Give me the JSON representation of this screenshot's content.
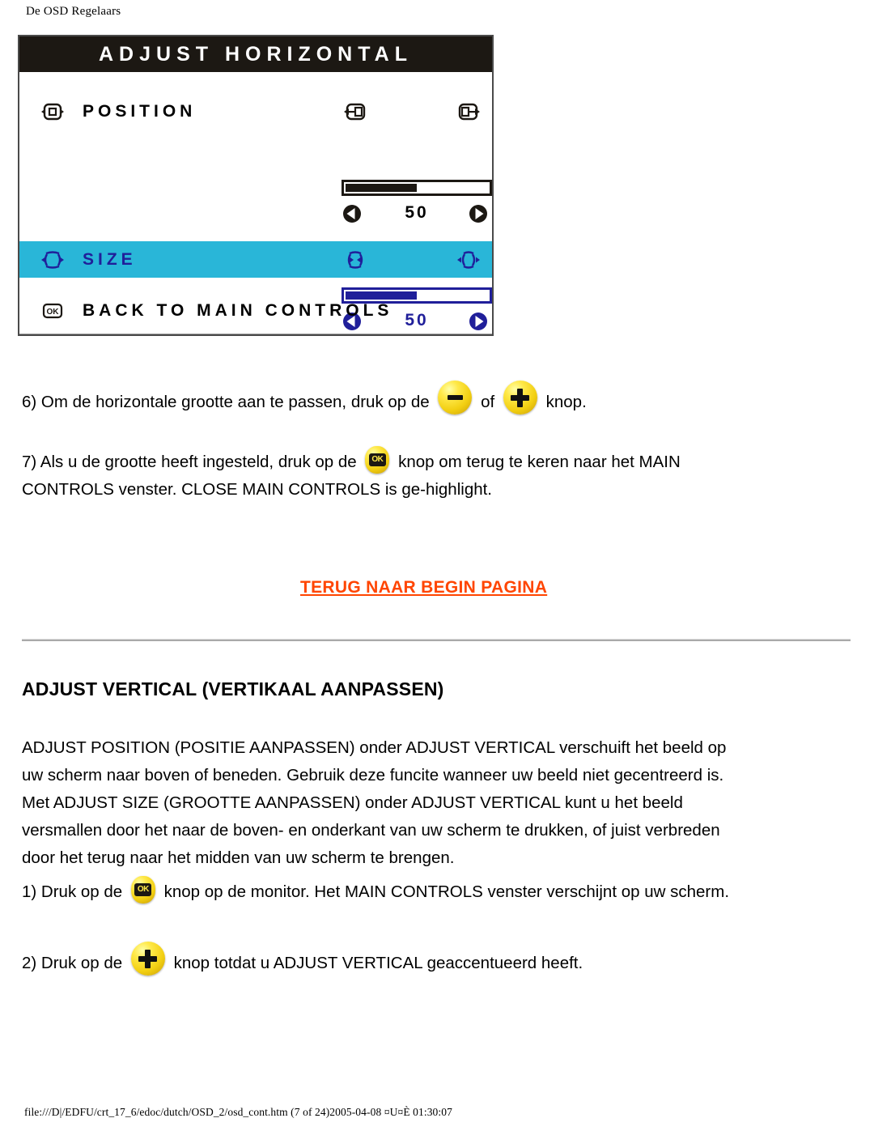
{
  "page": {
    "header": "De OSD Regelaars",
    "footer": "file:///D|/EDFU/crt_17_6/edoc/dutch/OSD_2/osd_cont.htm (7 of 24)2005-04-08 ¤U¤È 01:30:07"
  },
  "osd": {
    "title": "ADJUST HORIZONTAL",
    "rows": [
      {
        "label": "POSITION",
        "icon": "position-horizontal-icon",
        "left_icon": "move-left-icon",
        "right_icon": "move-right-icon",
        "value": "50",
        "fill_percent": 50,
        "highlighted": false
      },
      {
        "label": "SIZE",
        "icon": "size-horizontal-icon",
        "left_icon": "narrow-icon",
        "right_icon": "widen-icon",
        "value": "50",
        "fill_percent": 50,
        "highlighted": true
      }
    ],
    "footer_row": {
      "label": "BACK TO MAIN CONTROLS",
      "icon": "ok-box-icon"
    }
  },
  "steps": {
    "step6": {
      "pre": "6) Om de horizontale grootte aan te passen, druk op de",
      "mid": "of",
      "post": "knop.",
      "minus_button": "minus-button",
      "plus_button": "plus-button"
    },
    "step7": {
      "pre": "7) Als u de grootte heeft ingesteld, druk op de",
      "post": "knop om terug te keren naar het MAIN",
      "line2": "CONTROLS venster. CLOSE MAIN CONTROLS is ge-highlight.",
      "ok_button": "ok-button"
    },
    "step1": {
      "pre": "1) Druk op de",
      "post": "knop op de monitor. Het MAIN CONTROLS venster verschijnt op uw scherm.",
      "ok_button": "ok-button"
    },
    "step2": {
      "pre": "2) Druk op de",
      "post": "knop totdat u ADJUST VERTICAL geaccentueerd heeft.",
      "plus_button": "plus-button"
    }
  },
  "back_link": "TERUG NAAR BEGIN PAGINA",
  "section": {
    "heading": "ADJUST VERTICAL (VERTIKAAL AANPASSEN)",
    "body": [
      "ADJUST POSITION (POSITIE AANPASSEN) onder ADJUST VERTICAL verschuift het beeld op",
      "uw scherm naar boven of beneden. Gebruik deze funcite wanneer uw beeld niet gecentreerd is.",
      "Met ADJUST SIZE (GROOTTE AANPASSEN) onder ADJUST VERTICAL kunt u het beeld",
      "versmallen door het naar de boven- en onderkant van uw scherm te drukken, of juist verbreden",
      "door het terug naar het midden van uw scherm te brengen."
    ]
  },
  "colors": {
    "highlight": "#29b6d8",
    "highlight_text": "#201f9a",
    "link": "#ff4500",
    "osd_dark": "#1c1813",
    "button_yellow": "#ffe94a"
  }
}
